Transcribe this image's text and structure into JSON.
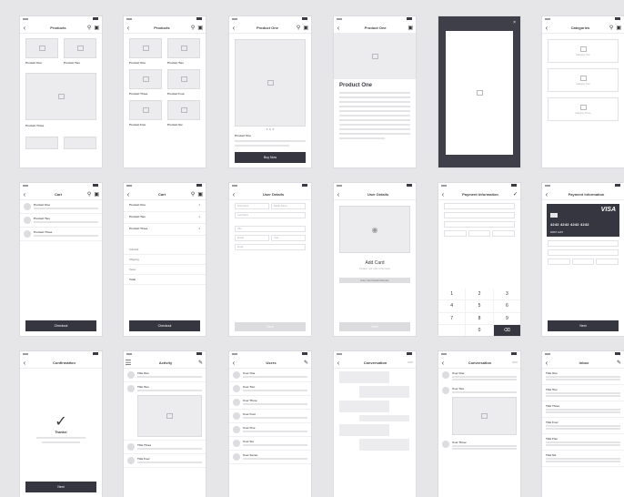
{
  "screens": {
    "products1": {
      "title": "Products",
      "tiles": [
        "Product One",
        "Product Two"
      ],
      "featured": "Product Three"
    },
    "products2": {
      "title": "Products",
      "tiles": [
        "Product One",
        "Product Two",
        "Product Three",
        "Product Four",
        "Product Five",
        "Product Six"
      ]
    },
    "product_one": {
      "title": "Product One",
      "name": "Product One",
      "button": "Buy Now"
    },
    "product_detail": {
      "title": "Product One",
      "heading": "Product One"
    },
    "categories": {
      "title": "Categories",
      "items": [
        "Category One",
        "Category Two",
        "Category Three"
      ]
    },
    "cart": {
      "title": "Cart",
      "items": [
        "Product One",
        "Product Two",
        "Product Three"
      ],
      "button": "Checkout"
    },
    "cart_totals": {
      "title": "Cart",
      "items": [
        "Product One",
        "Product Two",
        "Product Three"
      ],
      "qtys": [
        "2",
        "2",
        "2"
      ],
      "totals": [
        "Subtotal",
        "Shipping",
        "Taxes",
        "Total"
      ],
      "button": "Checkout"
    },
    "user_details1": {
      "title": "User Details",
      "fields": [
        "First Name",
        "Middle Name",
        "Last Name",
        "Title",
        "Month",
        "Year",
        "Email"
      ],
      "button": "Next"
    },
    "user_details2": {
      "title": "User Details",
      "heading": "Add Card",
      "sub": "Position your card in the frame",
      "link": "Enter Card Details Manually",
      "button": "Next"
    },
    "payment1": {
      "title": "Payment Information",
      "keys": [
        "1",
        "2",
        "3",
        "4",
        "5",
        "6",
        "7",
        "8",
        "9",
        "",
        "0",
        "⌫"
      ]
    },
    "payment2": {
      "title": "Payment Information",
      "visa": "VISA",
      "card_number": "4242 4242 4242 4242",
      "card_name": "FIRST LAST",
      "button": "Next"
    },
    "confirmation": {
      "title": "Confirmation",
      "heading": "Thanks!",
      "button": "Next"
    },
    "activity": {
      "title": "Activity",
      "items": [
        "Title One",
        "Title Two",
        "Title Three",
        "Title Four"
      ]
    },
    "users": {
      "title": "Users",
      "items": [
        "User One",
        "User Two",
        "User Three",
        "User Four",
        "User Five",
        "User Six",
        "User Seven"
      ]
    },
    "conversation1": {
      "title": "Conversation"
    },
    "conversation2": {
      "title": "Conversation",
      "users": [
        "User One",
        "User Two",
        "User Three"
      ]
    },
    "inbox": {
      "title": "Inbox",
      "items": [
        "Title One",
        "Title Two",
        "Title Three",
        "Title Four",
        "Title Five",
        "Title Six"
      ]
    }
  }
}
